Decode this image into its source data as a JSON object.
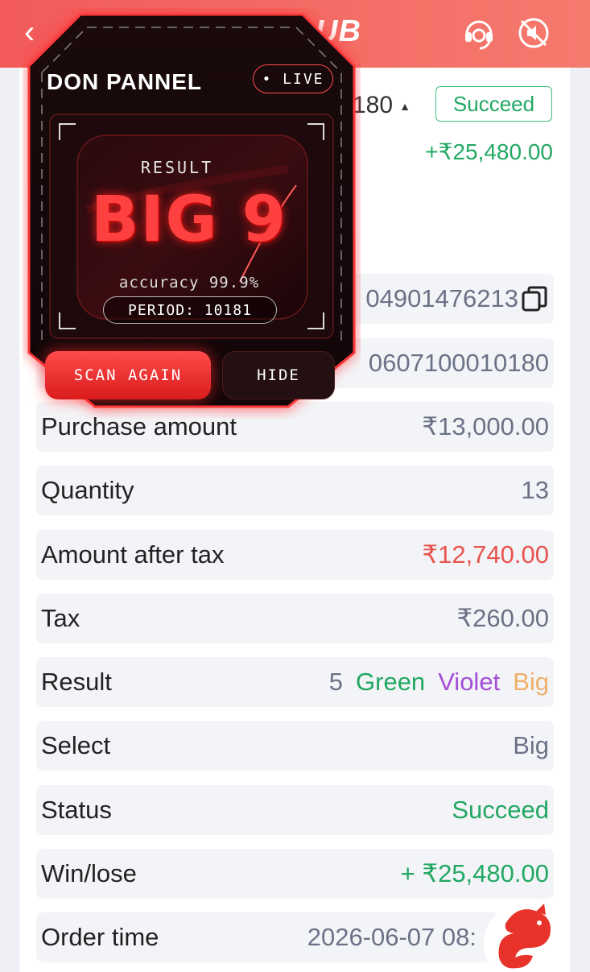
{
  "header": {
    "title_partial": "UB",
    "back_icon": "chevron-left-icon",
    "support_icon": "headset-icon",
    "sound_icon": "sound-off-icon"
  },
  "summary": {
    "amount_partial": "180",
    "caret": "▲",
    "status": "Succeed",
    "win": "+₹25,480.00"
  },
  "rows": {
    "order_number_partial": "04901476213",
    "period_partial": "0607100010180",
    "purchase_amount": {
      "label": "Purchase amount",
      "value": "₹13,000.00"
    },
    "quantity": {
      "label": "Quantity",
      "value": "13"
    },
    "amount_after_tax": {
      "label": "Amount after tax",
      "value": "₹12,740.00"
    },
    "tax": {
      "label": "Tax",
      "value": "₹260.00"
    },
    "result": {
      "label": "Result",
      "number": "5",
      "color1": "Green",
      "color2": "Violet",
      "size": "Big"
    },
    "select": {
      "label": "Select",
      "value": "Big"
    },
    "status": {
      "label": "Status",
      "value": "Succeed"
    },
    "win_lose": {
      "label": "Win/lose",
      "value": "+ ₹25,480.00"
    },
    "order_time": {
      "label": "Order time",
      "value": "2026-06-07 08:"
    }
  },
  "overlay": {
    "title": "DON PANNEL",
    "live": "• LIVE",
    "result_label": "RESULT",
    "result_value": "BIG 9",
    "accuracy": "accuracy 99.9%",
    "period": "PERIOD: 10181",
    "scan_button": "SCAN AGAIN",
    "hide_button": "HIDE"
  },
  "colors": {
    "header": "#f25a5a",
    "green": "#22a863",
    "red": "#e8544e",
    "violet": "#a34ed6",
    "big": "#efb06a"
  }
}
